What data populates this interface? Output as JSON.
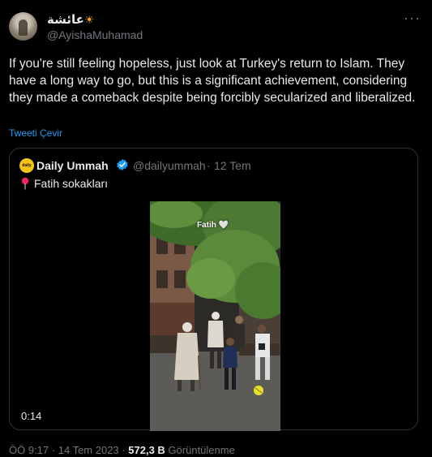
{
  "author": {
    "display_name": "عائشة",
    "sun_emoji": "☀",
    "handle": "@AyishaMuhamad"
  },
  "tweet": {
    "text": "If you're still feeling hopeless, just look at Turkey's return to Islam. They have a long way to go, but this is a significant achievement, considering they made a comeback despite being forcibly secularized and liberalized.",
    "translate_label": "Tweeti Çevir"
  },
  "quote": {
    "logo_text": "daily ummah",
    "name": "Daily Ummah",
    "handle": "@dailyummah",
    "separator": "·",
    "date": "12 Tem",
    "text": "Fatih sokakları",
    "video": {
      "overlay_label": "Fatih",
      "overlay_emoji": "🤍",
      "duration": "0:14"
    }
  },
  "footer": {
    "time": "ÖÖ 9:17",
    "separator": "·",
    "date": "14 Tem 2023",
    "views_count": "572,3 B",
    "views_label": "Görüntülenme"
  },
  "colors": {
    "background": "#000000",
    "text": "#e7e9ea",
    "muted": "#71767b",
    "link": "#1d9bf0",
    "border": "#2f3336",
    "verified": "#1d9bf0",
    "logo": "#f7c31a",
    "pin": "#f4245e"
  }
}
